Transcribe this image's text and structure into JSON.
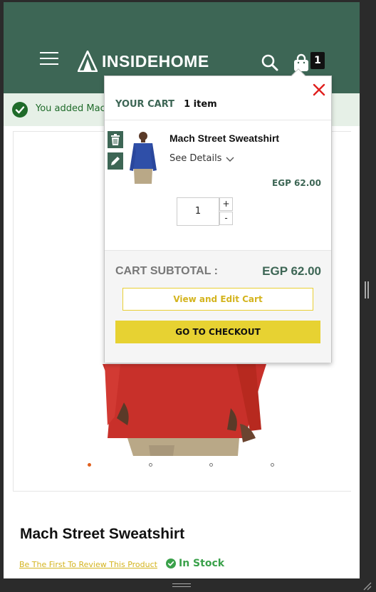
{
  "header": {
    "logo_text": "INSIDEHOME",
    "cart_count": "1",
    "icons": {
      "menu": "hamburger-menu-icon",
      "logo": "tent-logo-icon",
      "search": "search-icon",
      "cart": "shopping-bag-icon"
    },
    "background": "#3d6655"
  },
  "notice": {
    "text": "You added Mach",
    "icon": "check-circle-icon"
  },
  "gallery": {
    "dots_count": 4,
    "active_dot": 0
  },
  "product": {
    "title": "Mach Street Sweatshirt",
    "review_link": "Be The First To Review This Product",
    "stock": "In Stock"
  },
  "minicart": {
    "title": "YOUR CART",
    "count_text": "1 item",
    "close_icon": "close-icon",
    "item": {
      "name": "Mach Street Sweatshirt",
      "details_label": "See Details",
      "price": "EGP 62.00",
      "quantity": "1",
      "qty_plus": "+",
      "qty_minus": "-",
      "delete_icon": "trash-icon",
      "edit_icon": "pencil-icon"
    },
    "subtotal_label": "CART SUBTOTAL :",
    "subtotal_value": "EGP 62.00",
    "view_cart_label": "View and Edit Cart",
    "checkout_label": "GO TO CHECKOUT"
  },
  "colors": {
    "brand_green": "#3d6655",
    "accent_yellow": "#e7d232",
    "close_red": "#e0201e",
    "stock_green": "#3aa14a",
    "active_dot": "#e0601e"
  }
}
